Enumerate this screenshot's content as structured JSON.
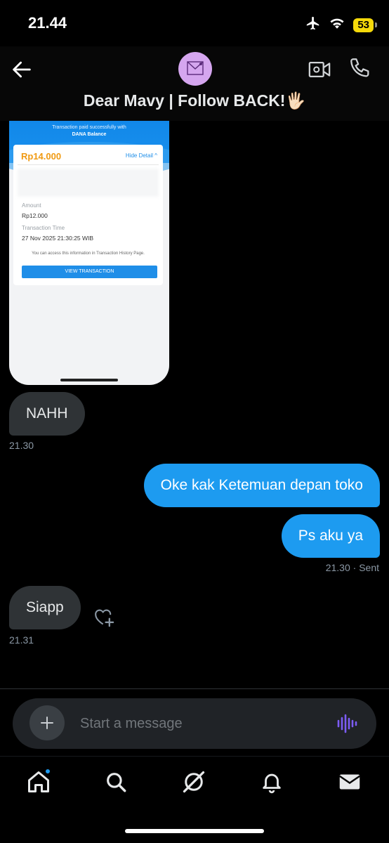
{
  "status_bar": {
    "time": "21.44",
    "battery": "53"
  },
  "header": {
    "title": "Dear Mavy | Follow BACK!🖐🏻"
  },
  "shared_image": {
    "subtitle_1": "Transaction paid successfully with",
    "subtitle_2": "DANA Balance",
    "total": "Rp14.000",
    "hide_detail": "Hide Detail ^",
    "amount_label": "Amount",
    "amount_value": "Rp12.000",
    "time_label": "Transaction Time",
    "time_value": "27 Nov 2025 21:30:25 WIB",
    "info": "You can access this information in Transaction History Page.",
    "button": "VIEW TRANSACTION"
  },
  "messages": [
    {
      "direction": "in",
      "text": "NAHH",
      "time": "21.30"
    },
    {
      "direction": "out",
      "text": "Oke kak Ketemuan depan toko"
    },
    {
      "direction": "out",
      "text": "Ps aku ya",
      "time": "21.30 · Sent"
    },
    {
      "direction": "in",
      "text": "Siapp",
      "time": "21.31"
    }
  ],
  "composer": {
    "placeholder": "Start a message"
  },
  "nav": {
    "items": [
      "home-icon",
      "search-icon",
      "grok-icon",
      "notifications-icon",
      "messages-icon"
    ]
  },
  "colors": {
    "accent": "#1d9bf0",
    "incoming_bubble": "#2f3336",
    "background": "#000000",
    "battery": "#f5d90a"
  }
}
